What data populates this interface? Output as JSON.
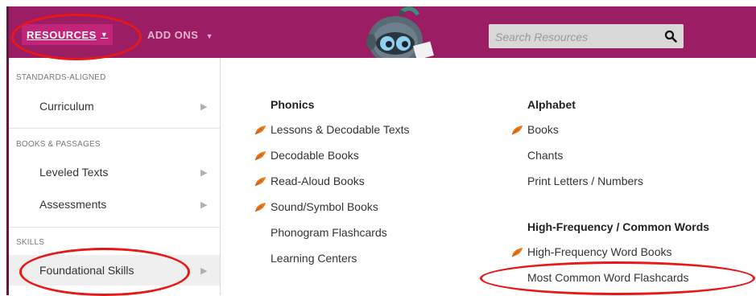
{
  "nav": {
    "resources_label": "RESOURCES",
    "addons_label": "ADD ONS",
    "search_placeholder": "Search Resources"
  },
  "sidebar": {
    "sections": [
      {
        "label": "STANDARDS-ALIGNED",
        "items": [
          {
            "label": "Curriculum"
          }
        ]
      },
      {
        "label": "BOOKS & PASSAGES",
        "items": [
          {
            "label": "Leveled Texts"
          },
          {
            "label": "Assessments"
          }
        ]
      },
      {
        "label": "SKILLS",
        "items": [
          {
            "label": "Foundational Skills",
            "active": true
          }
        ]
      }
    ]
  },
  "dropdown": {
    "phonics": {
      "title": "Phonics",
      "links": [
        {
          "label": "Lessons & Decodable Texts",
          "icon": "leaf-icon"
        },
        {
          "label": "Decodable Books",
          "icon": "leaf-icon"
        },
        {
          "label": "Read-Aloud Books",
          "icon": "leaf-icon"
        },
        {
          "label": "Sound/Symbol Books",
          "icon": "leaf-icon"
        },
        {
          "label": "Phonogram Flashcards"
        },
        {
          "label": "Learning Centers"
        }
      ]
    },
    "alphabet": {
      "title": "Alphabet",
      "links": [
        {
          "label": "Books",
          "icon": "leaf-icon"
        },
        {
          "label": "Chants"
        },
        {
          "label": "Print Letters / Numbers"
        }
      ]
    },
    "hfw": {
      "title": "High-Frequency / Common Words",
      "links": [
        {
          "label": "High-Frequency Word Books",
          "icon": "leaf-icon"
        },
        {
          "label": "Most Common Word Flashcards"
        }
      ]
    }
  },
  "colors": {
    "nav_bg": "#9b1d64",
    "nav_active": "#c2247a",
    "annotation": "#e81818",
    "leaf": "#e87a1e"
  }
}
